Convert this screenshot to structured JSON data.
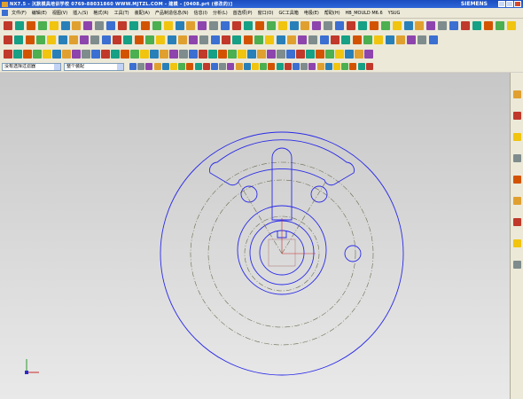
{
  "window": {
    "title": "NX7.5 - 沉默模具培训学校    0769-88031860    WWW.MJTZL.COM - 建模 - [0408.prt (修改的)]",
    "brand": "SIEMENS"
  },
  "menu": {
    "items": [
      "文件(F)",
      "编辑(E)",
      "视图(V)",
      "插入(S)",
      "格式(R)",
      "工具(T)",
      "装配(A)",
      "产品制造信息(N)",
      "信息(I)",
      "分析(L)",
      "首选项(P)",
      "窗口(O)",
      "GC工具箱",
      "电极(E)",
      "帮助(H)",
      "HB_MOULD M6.6",
      "YSUG"
    ]
  },
  "filter": {
    "selection_filter": "没有选择过滤器",
    "scope": "整个装配"
  },
  "icons": {
    "toolbar": [
      "new-icon",
      "open-icon",
      "save-icon",
      "sketch-icon",
      "extrude-icon",
      "revolve-icon",
      "hole-icon",
      "boss-icon",
      "blend-icon",
      "chamfer-icon",
      "shell-icon",
      "pattern-icon",
      "mirror-icon",
      "trim-icon",
      "text-icon",
      "curve-icon",
      "line-icon",
      "arc-icon",
      "circle-icon",
      "point-icon",
      "snap-icon",
      "view-icon",
      "render-icon",
      "measure-icon"
    ],
    "resource_bar": [
      "assembly-navigator-icon",
      "part-navigator-icon",
      "reuse-library-icon",
      "internet-icon",
      "history-icon",
      "system-materials-icon",
      "process-studio-icon",
      "roles-icon",
      "palette-icon"
    ]
  },
  "colors": {
    "title_bar": "#1a4dc0",
    "canvas_top": "#c7c7c7",
    "canvas_bottom": "#e9e9e9",
    "curve": "#2a2ae8",
    "centerline": "#6b6b50",
    "csys_x": "#cc2a2a",
    "csys_y": "#2a9a2a",
    "csys_z": "#2a2acc"
  }
}
